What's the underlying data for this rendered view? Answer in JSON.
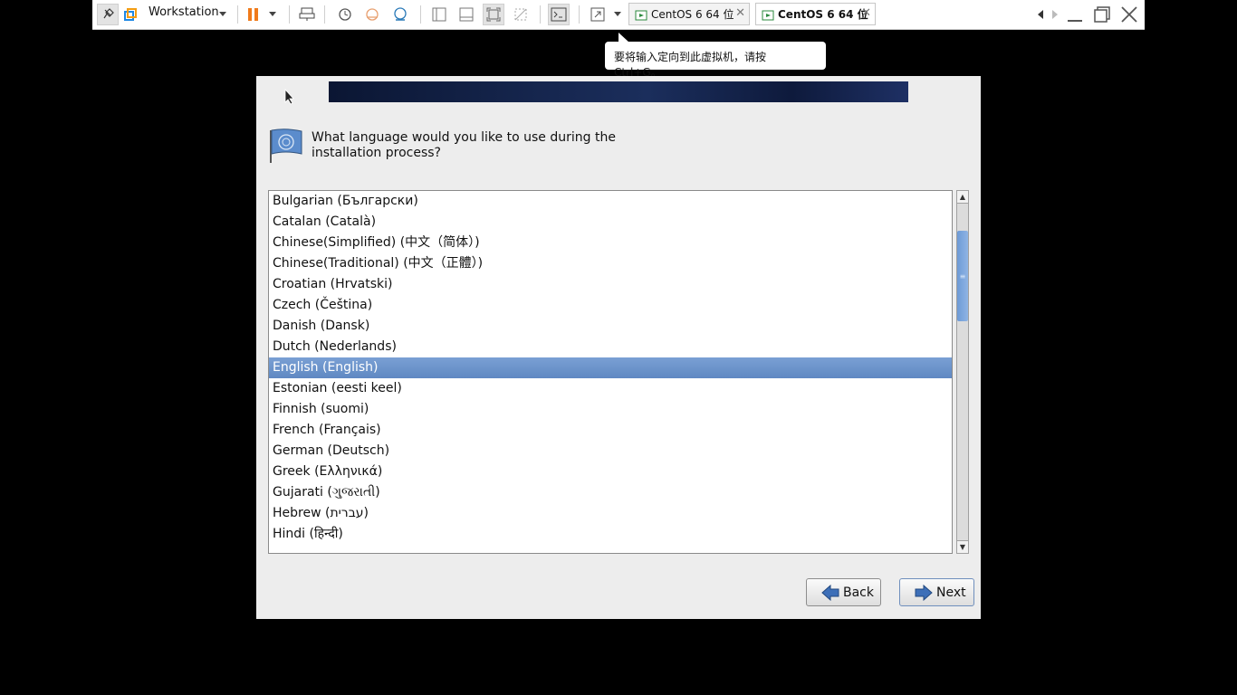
{
  "toolbar": {
    "workstation_label": "Workstation",
    "tabs": [
      {
        "label": "CentOS 6 64 位",
        "active": false
      },
      {
        "label": "CentOS 6 64 位",
        "active": true
      }
    ],
    "icons": [
      "pin-icon",
      "vmware-logo-icon",
      "pause-icon",
      "dropdown-icon",
      "send-keys-icon",
      "snapshot-icon",
      "revert-snapshot-icon",
      "snapshot-manager-icon",
      "library-icon",
      "thumbnail-icon",
      "full-screen-icon",
      "unity-icon",
      "console-icon",
      "stretch-icon",
      "tab-close-icon",
      "prev-tab-icon",
      "next-tab-icon",
      "minimize-icon",
      "restore-icon",
      "close-icon"
    ]
  },
  "tooltip": {
    "text": "要将输入定向到此虚拟机，请按 Ctrl+G。"
  },
  "installer": {
    "question": "What language would you like to use during the installation process?",
    "languages": [
      "Bulgarian (Български)",
      "Catalan (Català)",
      "Chinese(Simplified) (中文（简体）)",
      "Chinese(Traditional) (中文（正體）)",
      "Croatian (Hrvatski)",
      "Czech (Čeština)",
      "Danish (Dansk)",
      "Dutch (Nederlands)",
      "English (English)",
      "Estonian (eesti keel)",
      "Finnish (suomi)",
      "French (Français)",
      "German (Deutsch)",
      "Greek (Ελληνικά)",
      "Gujarati (ગુજરાતી)",
      "Hebrew (עברית)",
      "Hindi (हिन्दी)"
    ],
    "selected_index": 8,
    "back_label": "Back",
    "next_label": "Next",
    "selection_color": "#6a92c9"
  }
}
